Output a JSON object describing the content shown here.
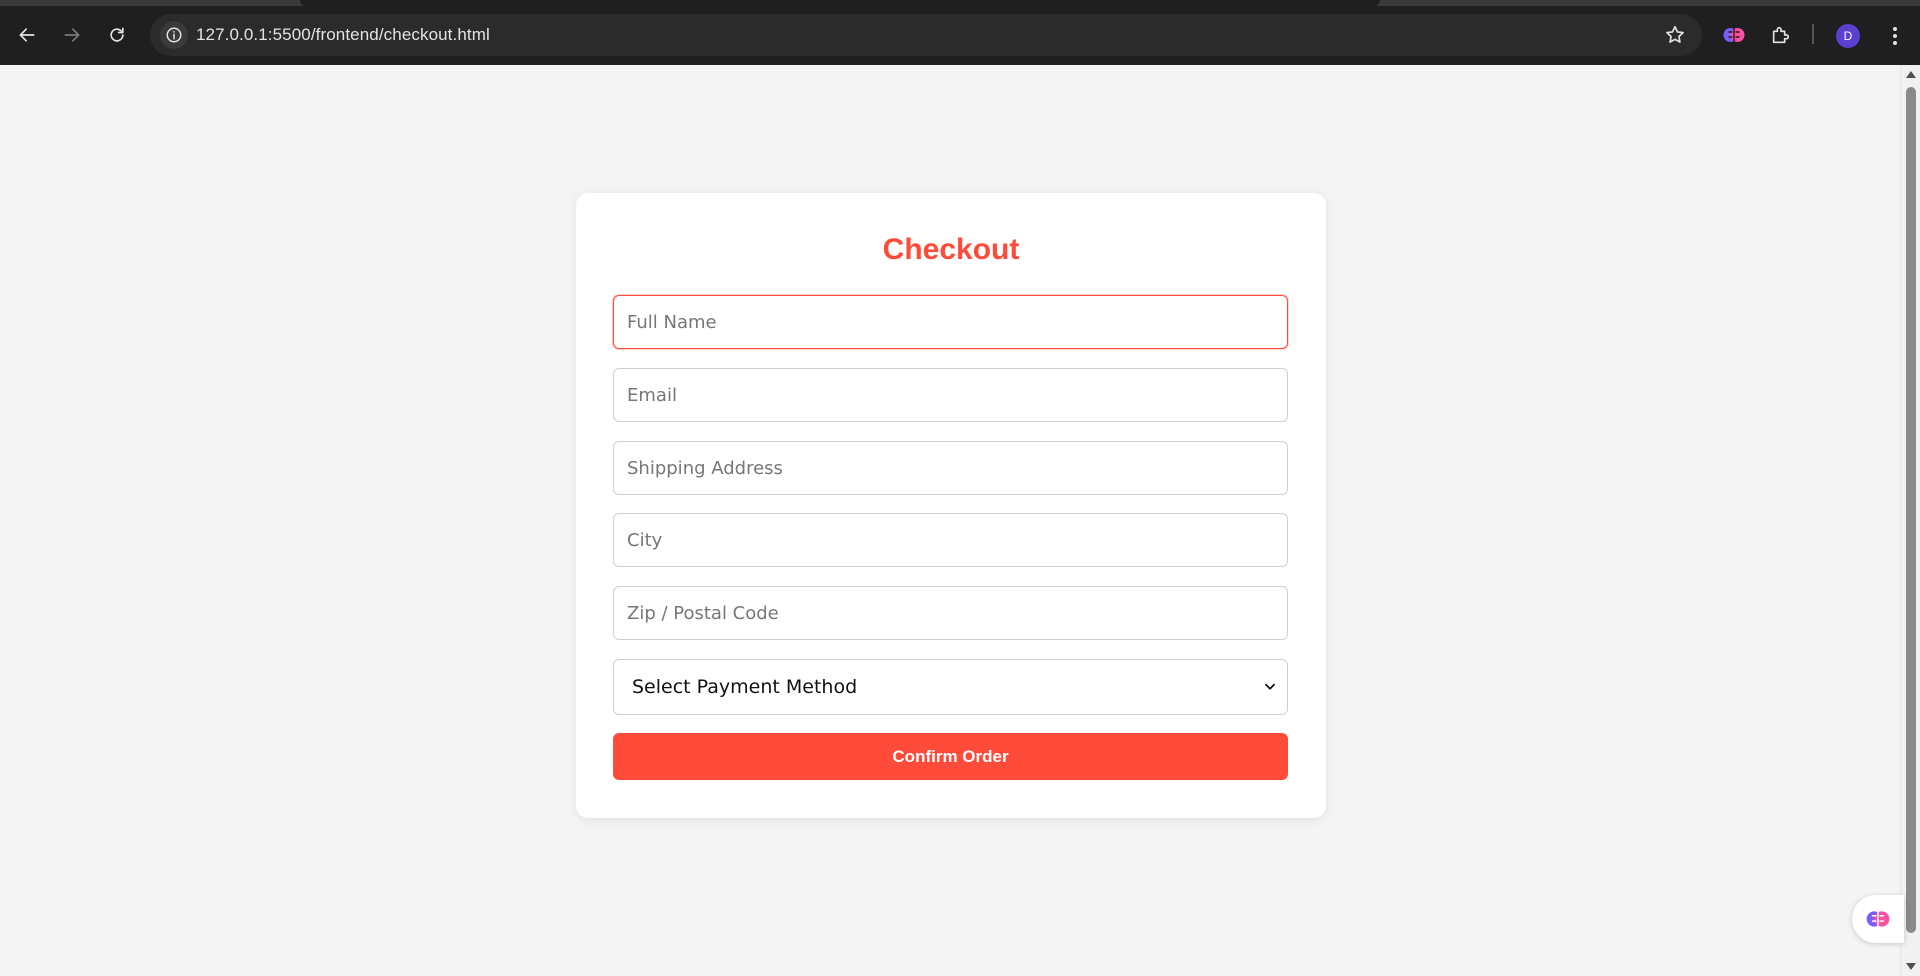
{
  "browser": {
    "url": "127.0.0.1:5500/frontend/checkout.html",
    "profile_initial": "D",
    "icons": {
      "back": "arrow-left-icon",
      "forward": "arrow-right-icon",
      "reload": "reload-icon",
      "site_info": "site-info-icon",
      "bookmark": "star-icon",
      "extension": "brain-extension-icon",
      "extensions_menu": "puzzle-icon",
      "menu": "more-vert-icon"
    }
  },
  "checkout": {
    "title": "Checkout",
    "fields": {
      "full_name": {
        "placeholder": "Full Name",
        "value": ""
      },
      "email": {
        "placeholder": "Email",
        "value": ""
      },
      "shipping_address": {
        "placeholder": "Shipping Address",
        "value": ""
      },
      "city": {
        "placeholder": "City",
        "value": ""
      },
      "zip": {
        "placeholder": "Zip / Postal Code",
        "value": ""
      }
    },
    "payment_method": {
      "selected": "Select Payment Method"
    },
    "confirm_label": "Confirm Order"
  },
  "colors": {
    "accent": "#ff4b3a",
    "page_background": "#f4f4f4",
    "chrome_background": "#1f1f1f"
  }
}
